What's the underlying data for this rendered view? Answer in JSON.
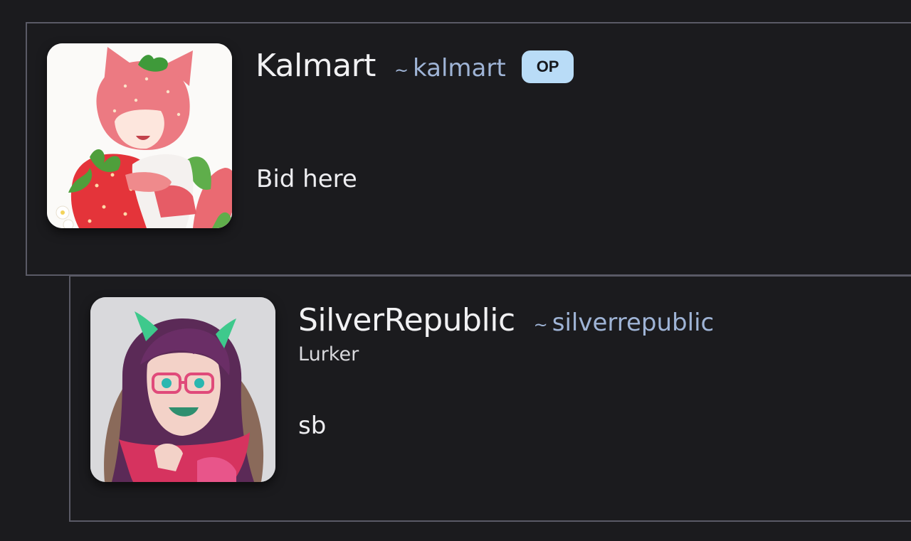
{
  "thread": {
    "comments": [
      {
        "display_name": "Kalmart",
        "handle_prefix": "~",
        "handle": "kalmart",
        "badge": "OP",
        "body": "Bid here",
        "avatar_icon": "strawberry-cat-avatar"
      },
      {
        "display_name": "SilverRepublic",
        "handle_prefix": "~",
        "handle": "silverrepublic",
        "user_title": "Lurker",
        "body": "sb",
        "avatar_icon": "horned-girl-avatar"
      }
    ]
  },
  "colors": {
    "background": "#1b1b1e",
    "border": "#5a5a66",
    "handle": "#9fb4d6",
    "op_badge": "#b9dcf7"
  }
}
